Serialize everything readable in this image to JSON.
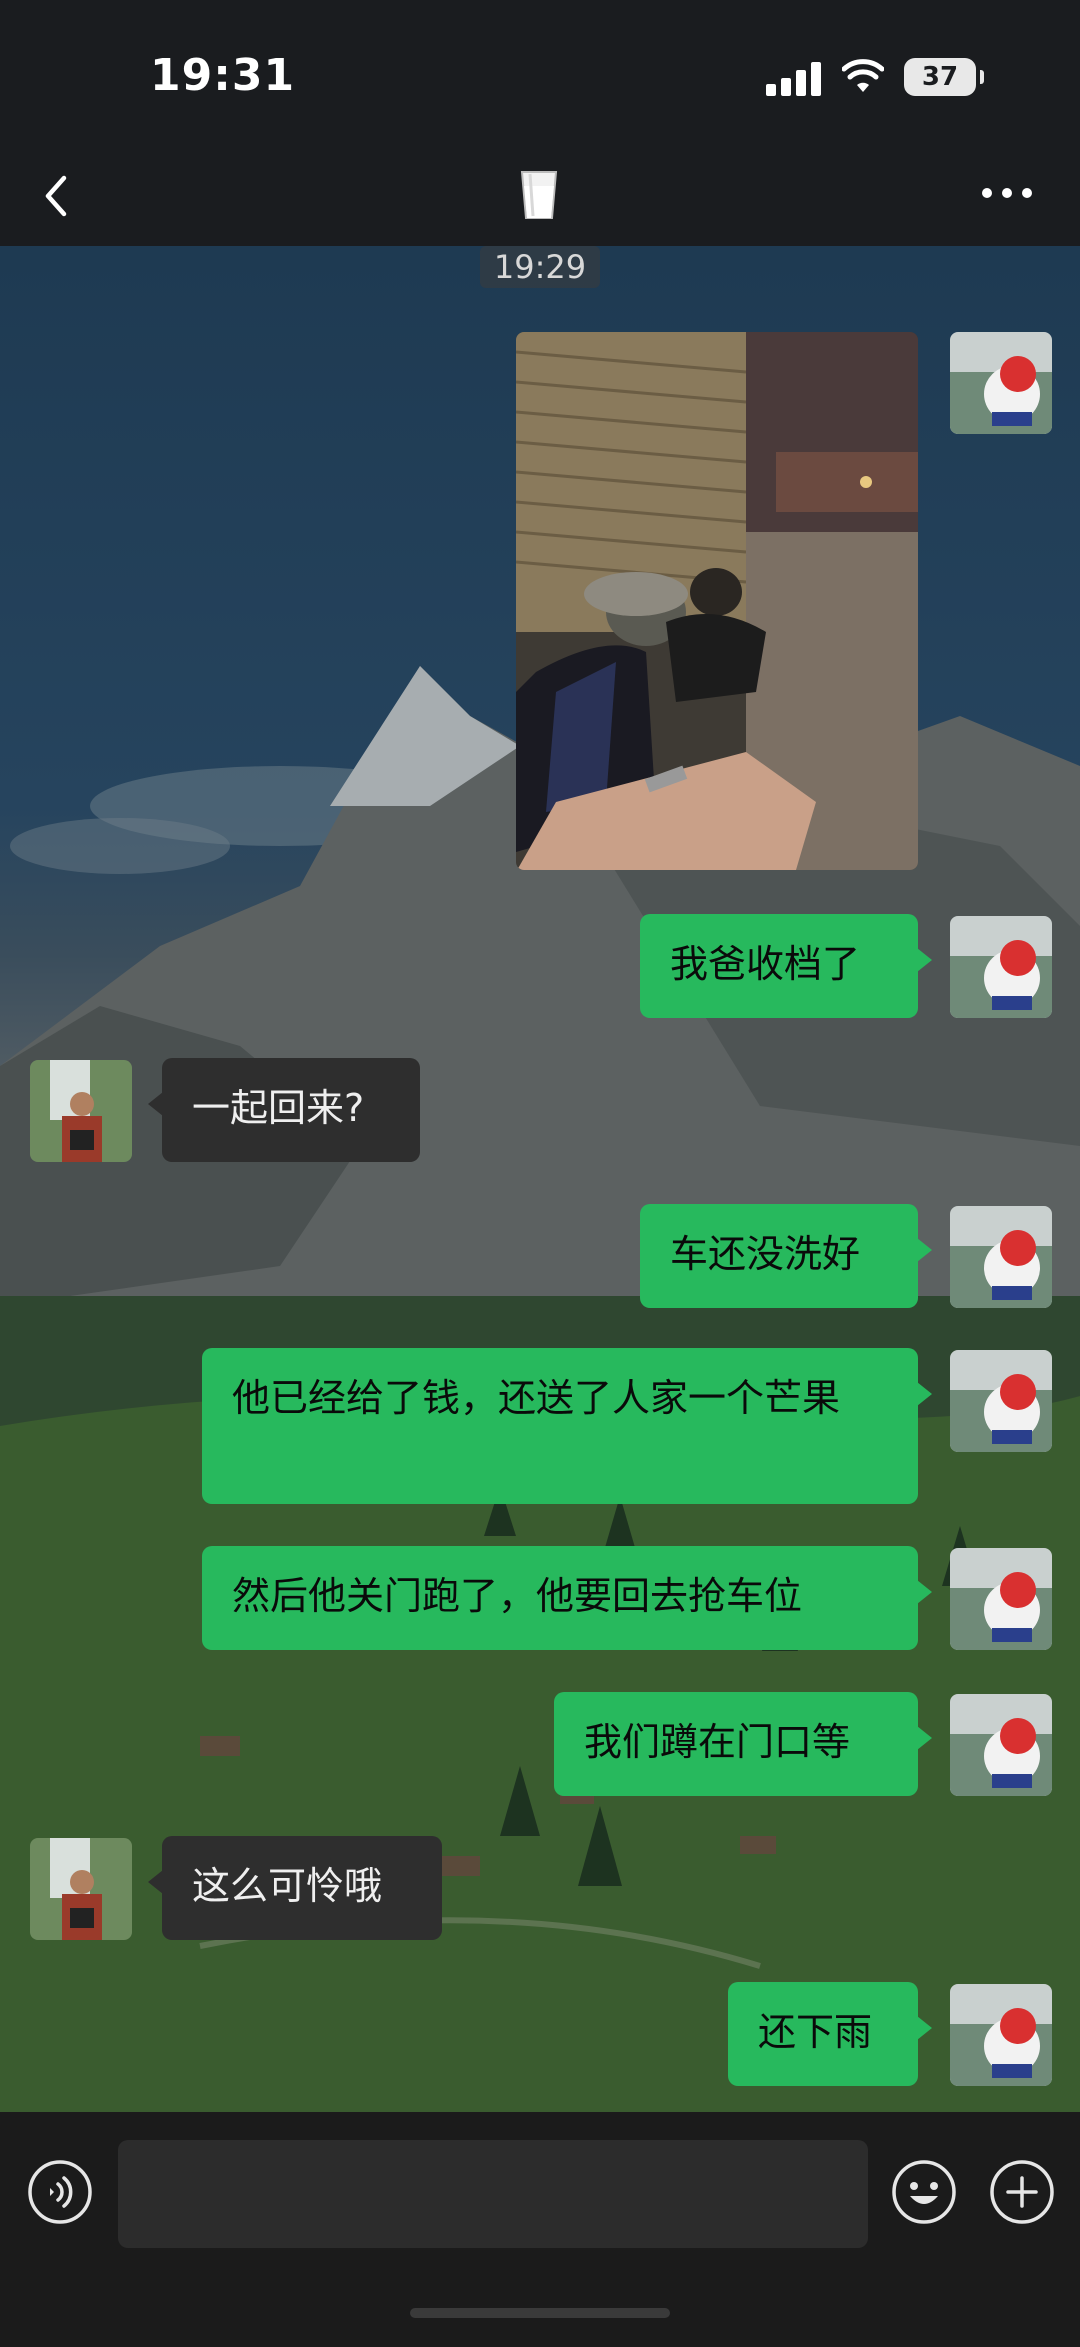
{
  "status_bar": {
    "time": "19:31",
    "battery": "37"
  },
  "nav": {
    "contact_emoji": "🥛"
  },
  "chat": {
    "timestamp": "19:29",
    "messages": [
      {
        "dir": "out",
        "type": "image",
        "description_icon": "photo"
      },
      {
        "dir": "out",
        "text": "我爸收档了"
      },
      {
        "dir": "in",
        "text": "一起回来?"
      },
      {
        "dir": "out",
        "text": "车还没洗好"
      },
      {
        "dir": "out",
        "text": "他已经给了钱，还送了人家一个芒果"
      },
      {
        "dir": "out",
        "text": "然后他关门跑了，他要回去抢车位"
      },
      {
        "dir": "out",
        "text": "我们蹲在门口等"
      },
      {
        "dir": "in",
        "text": "这么可怜哦"
      },
      {
        "dir": "out",
        "text": "还下雨"
      }
    ]
  },
  "input_bar": {
    "placeholder": ""
  },
  "colors": {
    "outgoing_bubble": "#27b95d",
    "incoming_bubble": "#2e2e2e",
    "bar": "#1a1c1f"
  }
}
